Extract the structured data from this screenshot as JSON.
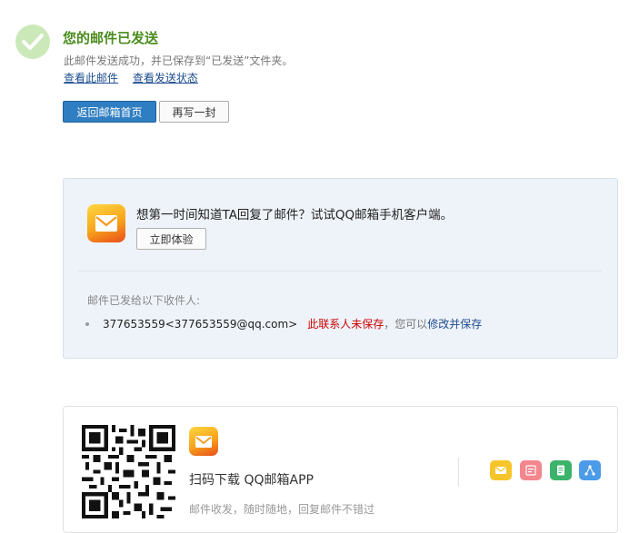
{
  "header": {
    "title": "您的邮件已发送",
    "subtitle": "此邮件发送成功，并已保存到“已发送”文件夹。",
    "view_mail_link": "查看此邮件",
    "view_status_link": "查看发送状态"
  },
  "actions": {
    "back_button": "返回邮箱首页",
    "rewrite_button": "再写一封"
  },
  "promo": {
    "text": "想第一时间知道TA回复了邮件？试试QQ邮箱手机客户端。",
    "try_button": "立即体验"
  },
  "recipients": {
    "label": "邮件已发给以下收件人:",
    "items": [
      {
        "email": "377653559<377653559@qq.com>",
        "unsaved": "此联系人未保存",
        "hint": "，您可以",
        "modify_link": "修改并保存"
      }
    ]
  },
  "app_download": {
    "title": "扫码下载 QQ邮箱APP",
    "subtitle": "邮件收发，随时随地，回复邮件不错过"
  },
  "colors": {
    "title_green": "#4a8c1e",
    "primary_blue": "#2f7ec2",
    "link_blue": "#1d4c8f",
    "warning_red": "#cc0000",
    "panel_bg": "#eef3f9"
  },
  "icons": {
    "success": "checkmark-icon",
    "app": "qq-mail-envelope-icon",
    "features": [
      "mail-feature-icon",
      "calendar-feature-icon",
      "note-feature-icon",
      "share-feature-icon"
    ]
  }
}
